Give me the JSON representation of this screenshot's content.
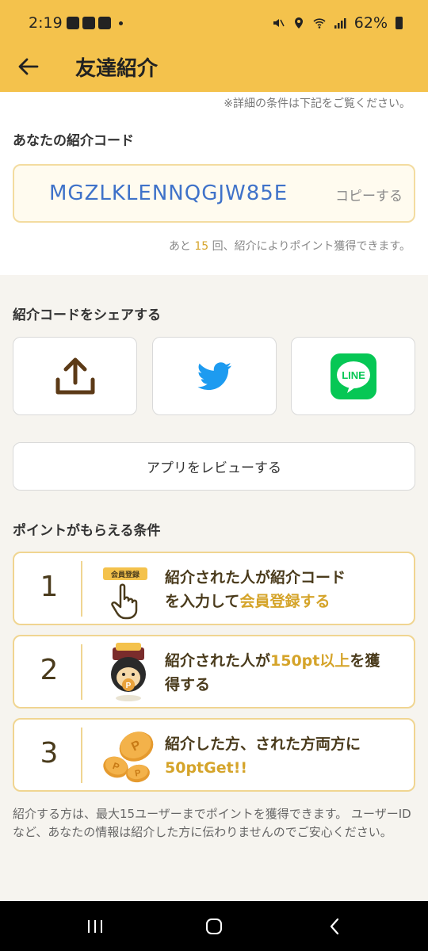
{
  "status_bar": {
    "time": "2:19",
    "battery": "62%"
  },
  "header": {
    "title": "友達紹介"
  },
  "notice": "※詳細の条件は下記をご覧ください。",
  "referral": {
    "label": "あなたの紹介コード",
    "code": "MGZLKLENNQGJW85E",
    "copy_label": "コピーする",
    "remaining_prefix": "あと",
    "remaining_count": "15",
    "remaining_suffix": "回、紹介によりポイント獲得できます。"
  },
  "share": {
    "label": "紹介コードをシェアする",
    "buttons": [
      {
        "icon": "upload-share-icon"
      },
      {
        "icon": "twitter-icon"
      },
      {
        "icon": "line-icon",
        "text": "LINE"
      }
    ],
    "review_label": "アプリをレビューする"
  },
  "conditions": {
    "label": "ポイントがもらえる条件",
    "items": [
      {
        "number": "1",
        "badge": "会員登録",
        "line1": "紹介された人が紹介コード",
        "line2_plain": "を入力して",
        "line2_highlight": "会員登録する"
      },
      {
        "number": "2",
        "line1_plain": "紹介された人が",
        "line1_highlight": "150pt以上",
        "line1_tail": "を獲",
        "line2": "得する"
      },
      {
        "number": "3",
        "line1": "紹介した方、された方両方に",
        "line2_highlight": "50ptGet!!"
      }
    ]
  },
  "footnote": "紹介する方は、最大15ユーザーまでポイントを獲得できます。 ユーザーIDなど、あなたの情報は紹介した方に伝わりませんのでご安心ください。",
  "colors": {
    "header": "#f4c24c",
    "accent": "#d5a42a",
    "code": "#3f72c9",
    "twitter": "#1d9bf0",
    "line": "#06c755"
  }
}
